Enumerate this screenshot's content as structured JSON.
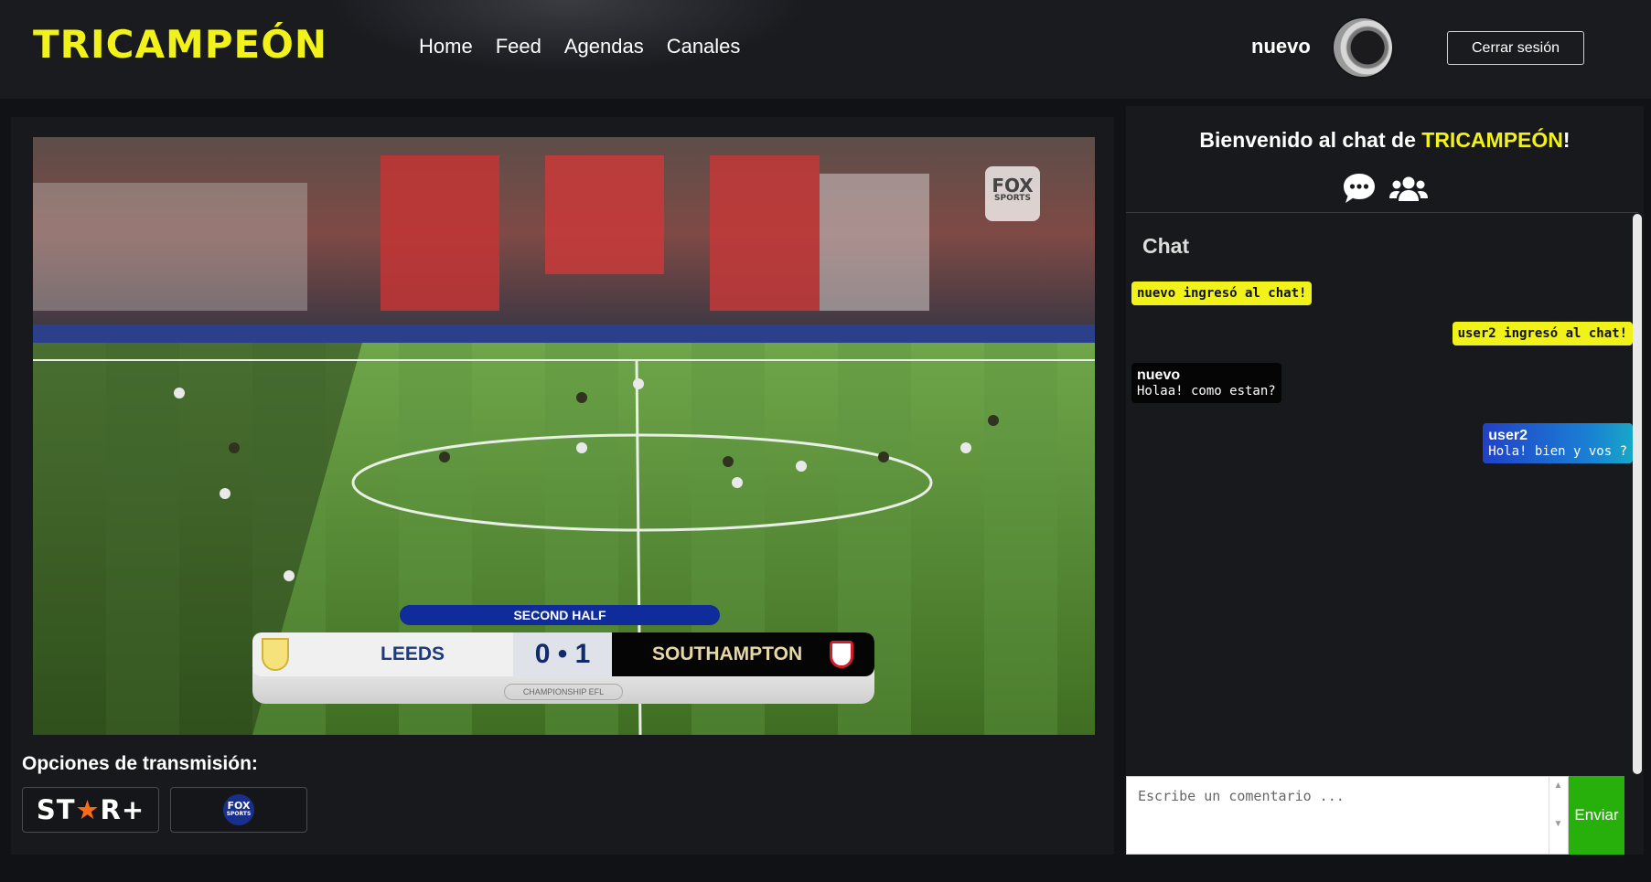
{
  "header": {
    "logo": "TRICAMPEÓN",
    "nav": [
      "Home",
      "Feed",
      "Agendas",
      "Canales"
    ],
    "username": "nuevo",
    "logout_label": "Cerrar sesión"
  },
  "video": {
    "broadcaster": "FOX",
    "broadcaster_sub": "SPORTS",
    "period": "SECOND HALF",
    "home_team": "LEEDS",
    "away_team": "SOUTHAMPTON",
    "score": "0 • 1",
    "league": "CHAMPIONSHIP  EFL"
  },
  "stream_options": {
    "label": "Opciones de transmisión:",
    "options": [
      {
        "name": "Star+",
        "text_a": "ST",
        "text_star": "★",
        "text_b": "R+"
      },
      {
        "name": "Fox Sports",
        "text": "FOX",
        "sub": "SPORTS"
      }
    ]
  },
  "chat": {
    "welcome_prefix": "Bienvenido al chat de ",
    "welcome_brand": "TRICAMPEÓN",
    "welcome_suffix": "!",
    "heading": "Chat",
    "system_messages": [
      "nuevo ingresó al chat!",
      "user2 ingresó al chat!"
    ],
    "messages": [
      {
        "user": "nuevo",
        "text": "Holaa! como estan?",
        "side": "left"
      },
      {
        "user": "user2",
        "text": "Hola! bien y vos ?",
        "side": "right"
      }
    ],
    "input_placeholder": "Escribe un comentario ...",
    "send_label": "Enviar",
    "icons": [
      "chat-bubble-icon",
      "users-icon"
    ]
  },
  "colors": {
    "brand_yellow": "#f1f21a",
    "send_green": "#27b00b",
    "background": "#111215"
  }
}
